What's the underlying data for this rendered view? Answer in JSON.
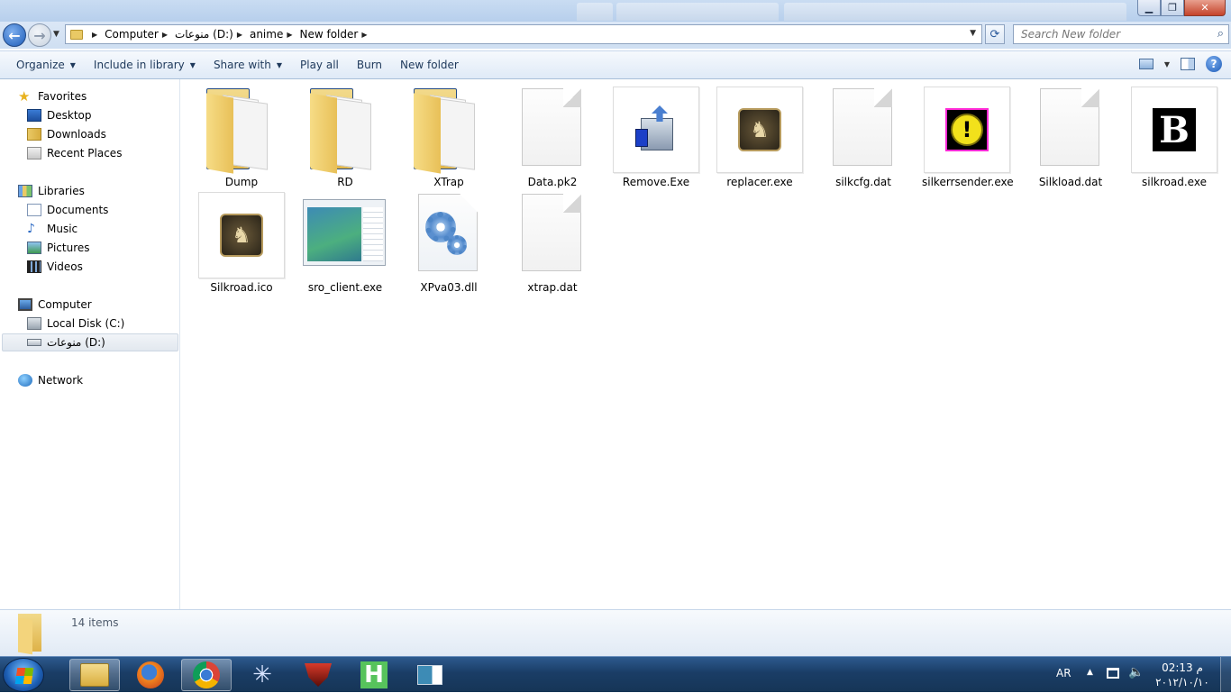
{
  "window": {
    "minimize": "▁",
    "maximize": "❐",
    "close": "✕"
  },
  "address": {
    "crumbs": [
      "Computer",
      "منوعات (D:)",
      "anime",
      "New folder"
    ],
    "search_placeholder": "Search New folder"
  },
  "toolbar": {
    "organize": "Organize",
    "include": "Include in library",
    "share": "Share with",
    "play_all": "Play all",
    "burn": "Burn",
    "new_folder": "New folder"
  },
  "nav": {
    "favorites": "Favorites",
    "desktop": "Desktop",
    "downloads": "Downloads",
    "recent": "Recent Places",
    "libraries": "Libraries",
    "documents": "Documents",
    "music": "Music",
    "pictures": "Pictures",
    "videos": "Videos",
    "computer": "Computer",
    "local_c": "Local Disk (C:)",
    "drive_d": "منوعات (D:)",
    "network": "Network"
  },
  "files": [
    {
      "name": "Dump",
      "icon": "folder-icon"
    },
    {
      "name": "RD",
      "icon": "folder-icon"
    },
    {
      "name": "XTrap",
      "icon": "folder-icon"
    },
    {
      "name": "Data.pk2",
      "icon": "blank-file-icon"
    },
    {
      "name": "Remove.Exe",
      "icon": "uninstall-icon"
    },
    {
      "name": "replacer.exe",
      "icon": "silkroad-emblem-icon"
    },
    {
      "name": "silkcfg.dat",
      "icon": "blank-file-icon"
    },
    {
      "name": "silkerrsender.exe",
      "icon": "warning-icon"
    },
    {
      "name": "Silkload.dat",
      "icon": "blank-file-icon"
    },
    {
      "name": "silkroad.exe",
      "icon": "b-logo-icon"
    },
    {
      "name": "Silkroad.ico",
      "icon": "silkroad-emblem-icon"
    },
    {
      "name": "sro_client.exe",
      "icon": "window-preview-icon"
    },
    {
      "name": "XPva03.dll",
      "icon": "gear-file-icon"
    },
    {
      "name": "xtrap.dat",
      "icon": "blank-file-icon"
    }
  ],
  "status": {
    "count": "14 items"
  },
  "tray": {
    "lang": "AR",
    "time": "02:13 م",
    "date": "٢٠١٢/١٠/١٠"
  }
}
